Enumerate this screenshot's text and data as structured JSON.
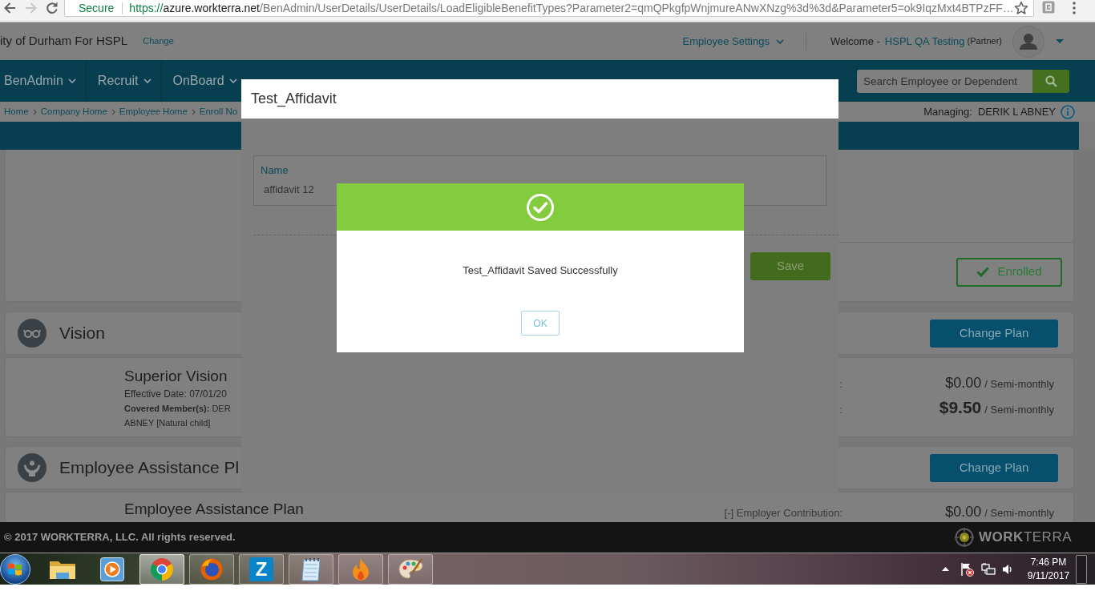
{
  "browser": {
    "history_buttons": [
      {
        "disabled": false
      },
      {
        "disabled": true
      }
    ],
    "security_label": "Secure",
    "url": {
      "scheme": "https://",
      "host": "azure.workterra.net",
      "path": "/BenAdmin/UserDetails/UserDetails/LoadEligibleBenefitTypes?Parameter2=qmQPkgfpWnjmureANwXNzg%3d%3d&Parameter5=ok9IqzMxt4BTPzFF…"
    }
  },
  "header": {
    "company": "ity of Durham For HSPL",
    "change_link": "Change",
    "settings_menu": "Employee Settings",
    "welcome": "Welcome -",
    "user_name": "HSPL QA Testing",
    "user_role": "(Partner)"
  },
  "nav": {
    "items": [
      {
        "label": "BenAdmin"
      },
      {
        "label": "Recruit"
      },
      {
        "label": "OnBoard"
      }
    ],
    "search": {
      "placeholder": "Search Employee or Dependent"
    }
  },
  "breadcrumb": {
    "items": [
      "Home",
      "Company Home",
      "Employee Home",
      "Enroll No"
    ],
    "managing_label": "Managing:",
    "managing_name": "DERIK L ABNEY"
  },
  "enrollment": {
    "status_button": "Enrolled"
  },
  "plans": [
    {
      "title": "Vision",
      "button": "Change Plan",
      "plan_name": "Superior Vision",
      "details": [
        "Effective Date: 07/01/20"
      ],
      "members": [
        "**Covered Member(s):** DER",
        "ABNEY [Natural child]"
      ],
      "costs": [
        {
          "kind": "line",
          "label": ":",
          "amount": "$0.00",
          "period": "/ Semi-monthly"
        },
        {
          "kind": "total",
          "label": ":",
          "amount": "$9.50",
          "period": "/ Semi-monthly"
        }
      ]
    },
    {
      "title": "Employee Assistance Pl",
      "button": "Change Plan",
      "plan_name": "Employee Assistance Plan",
      "costs": [
        {
          "kind": "line",
          "label": "[-] Employer Contribution:",
          "amount": "$0.00",
          "period": "/ Semi-monthly"
        }
      ]
    }
  ],
  "dialog": {
    "title": "Test_Affidavit",
    "field": {
      "label": "Name",
      "value": "affidavit 12"
    },
    "save_button": "Save"
  },
  "alert": {
    "message": "Test_Affidavit Saved Successfully",
    "ok_button": "OK"
  },
  "footer": {
    "copyright": "© 2017 WORKTERRA, LLC. All rights reserved.",
    "brand": "**WORK**TERRA"
  },
  "taskbar": {
    "apps": [
      {
        "running": false,
        "selected": false
      },
      {
        "running": false,
        "selected": false
      },
      {
        "running": true,
        "selected": true
      },
      {
        "running": true,
        "selected": false
      },
      {
        "running": true,
        "selected": false,
        "glyph": "Z"
      },
      {
        "running": true,
        "selected": false
      },
      {
        "running": true,
        "selected": false
      },
      {
        "running": true,
        "selected": false
      }
    ],
    "clock": {
      "time": "7:46 PM",
      "date": "9/11/2017"
    }
  }
}
